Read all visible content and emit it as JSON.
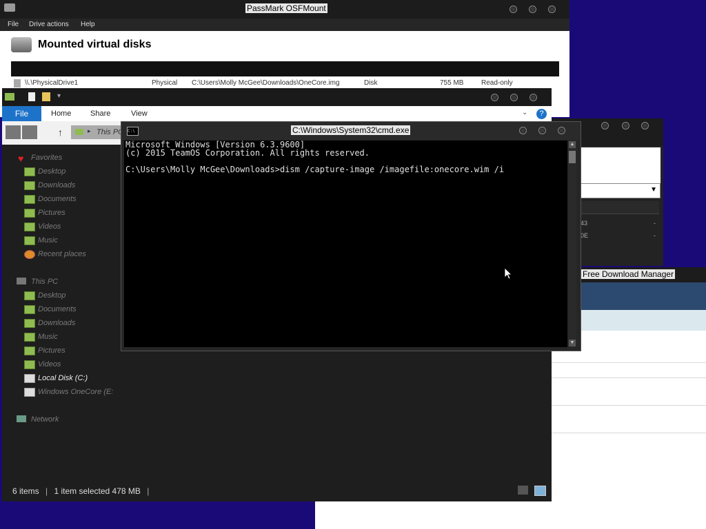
{
  "osfmount": {
    "title": "PassMark OSFMount",
    "menu": [
      "File",
      "Drive actions",
      "Help"
    ],
    "heading": "Mounted virtual disks",
    "row": {
      "drive": "\\\\.\\PhysicalDrive1",
      "type": "Physical",
      "path": "C:\\Users\\Molly McGee\\Downloads\\OneCore.img",
      "media": "Disk",
      "size": "755 MB",
      "access": "Read-only"
    }
  },
  "fdm": {
    "title": "Free Download Manager"
  },
  "middle_window": {
    "rows": [
      {
        "left": "43",
        "right": "-"
      },
      {
        "left": "0E",
        "right": "-"
      }
    ]
  },
  "explorer": {
    "ribbon_tabs": [
      "File",
      "Home",
      "Share",
      "View"
    ],
    "address": "This PC",
    "nav": {
      "favorites_label": "Favorites",
      "favorites": [
        "Desktop",
        "Downloads",
        "Documents",
        "Pictures",
        "Videos",
        "Music",
        "Recent places"
      ],
      "thispc_label": "This PC",
      "thispc": [
        "Desktop",
        "Documents",
        "Downloads",
        "Music",
        "Pictures",
        "Videos",
        "Local Disk (C:)",
        "Windows OneCore (E:"
      ],
      "network_label": "Network"
    },
    "status": {
      "items": "6 items",
      "selected": "1 item selected  478 MB"
    }
  },
  "cmd": {
    "title": "C:\\Windows\\System32\\cmd.exe",
    "icon_text": "C:\\",
    "lines": [
      "Microsoft Windows [Version 6.3.9600]",
      "(c) 2015 TeamOS Corporation. All rights reserved.",
      "",
      "C:\\Users\\Molly McGee\\Downloads>dism /capture-image /imagefile:onecore.wim /i"
    ]
  },
  "colors": {
    "desktop": "#1a0a78",
    "file_tab": "#1d73c9",
    "fdm_band": "#2c4a6f"
  }
}
